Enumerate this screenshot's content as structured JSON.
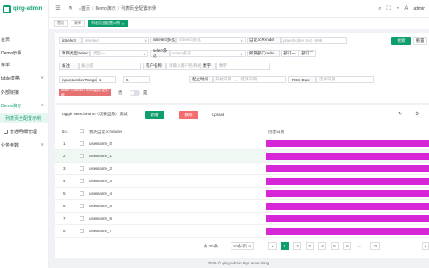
{
  "app": {
    "title": "qing-admin"
  },
  "sidebar": {
    "items": [
      {
        "label": "首页"
      },
      {
        "label": "Demo示例"
      },
      {
        "label": "菜单"
      },
      {
        "label": "table表格"
      },
      {
        "label": "外部链接"
      },
      {
        "label": "Demo演示"
      },
      {
        "label": "列表页全配置示例"
      },
      {
        "label": "普通明细管理"
      },
      {
        "label": "业务参数"
      }
    ]
  },
  "header": {
    "breadcrumb": [
      "首页",
      "Demo演示",
      "列表页全配置示例"
    ],
    "user": "admin"
  },
  "tabs": [
    {
      "label": "首页"
    },
    {
      "label": "表单"
    },
    {
      "label": "列表页全配置示例"
    }
  ],
  "form": {
    "row1": {
      "l1": "isSelect",
      "v1": "isSelect",
      "l2": "isSelect多选",
      "v2": "isSelect多选",
      "l3": "自定义Render",
      "v3": "placeholder text  -  999",
      "search": "搜索",
      "reset": "重置"
    },
    "row2": {
      "l1": "项目类型Select",
      "v1": "类型一",
      "l2": "select多选",
      "v2": "select多选",
      "l3": "所属部门radio",
      "opt1": "部门一",
      "opt2": "部门二"
    },
    "row3": {
      "l1": "备注",
      "v1": "备注提",
      "l2": "客户名称",
      "v2": "请输入客户名称(模糊)",
      "l3": "数字",
      "v3": "数字"
    },
    "row4": {
      "l1": "inputNumberRange",
      "min": "1",
      "tilde": "~",
      "max": "5",
      "l2": "起止时间",
      "start": "开始日期",
      "to": "→",
      "end": "结束日期",
      "l3": "创建 Date",
      "v3": "请选择日期",
      "l4": "RSS Date",
      "v4": "选择日期"
    },
    "row5": {
      "l1": "label (custom string)标记示例",
      "opt": "否",
      "opt2": "是"
    }
  },
  "toolbar": {
    "title": "toggle searchForm（切换显隐）测试",
    "add": "新增",
    "delete": "删除",
    "upload": "Upload"
  },
  "table": {
    "headers": [
      "No.",
      "",
      "我的自定义header",
      "创建日期"
    ],
    "rows": [
      {
        "no": "1",
        "name": "username_0"
      },
      {
        "no": "2",
        "name": "username_1"
      },
      {
        "no": "3",
        "name": "username_2"
      },
      {
        "no": "4",
        "name": "username_3"
      },
      {
        "no": "5",
        "name": "username_4"
      },
      {
        "no": "6",
        "name": "username_5"
      },
      {
        "no": "7",
        "name": "username_6"
      },
      {
        "no": "8",
        "name": "username_7"
      }
    ]
  },
  "pagination": {
    "total": "共 30 条",
    "size": "10条/页",
    "prev": "<",
    "pages": [
      "1",
      "2",
      "3",
      "4",
      "5",
      "6",
      "···",
      "10"
    ],
    "next": ">"
  },
  "footer": {
    "text": "2026 © qing-admin By LanceJiang."
  }
}
